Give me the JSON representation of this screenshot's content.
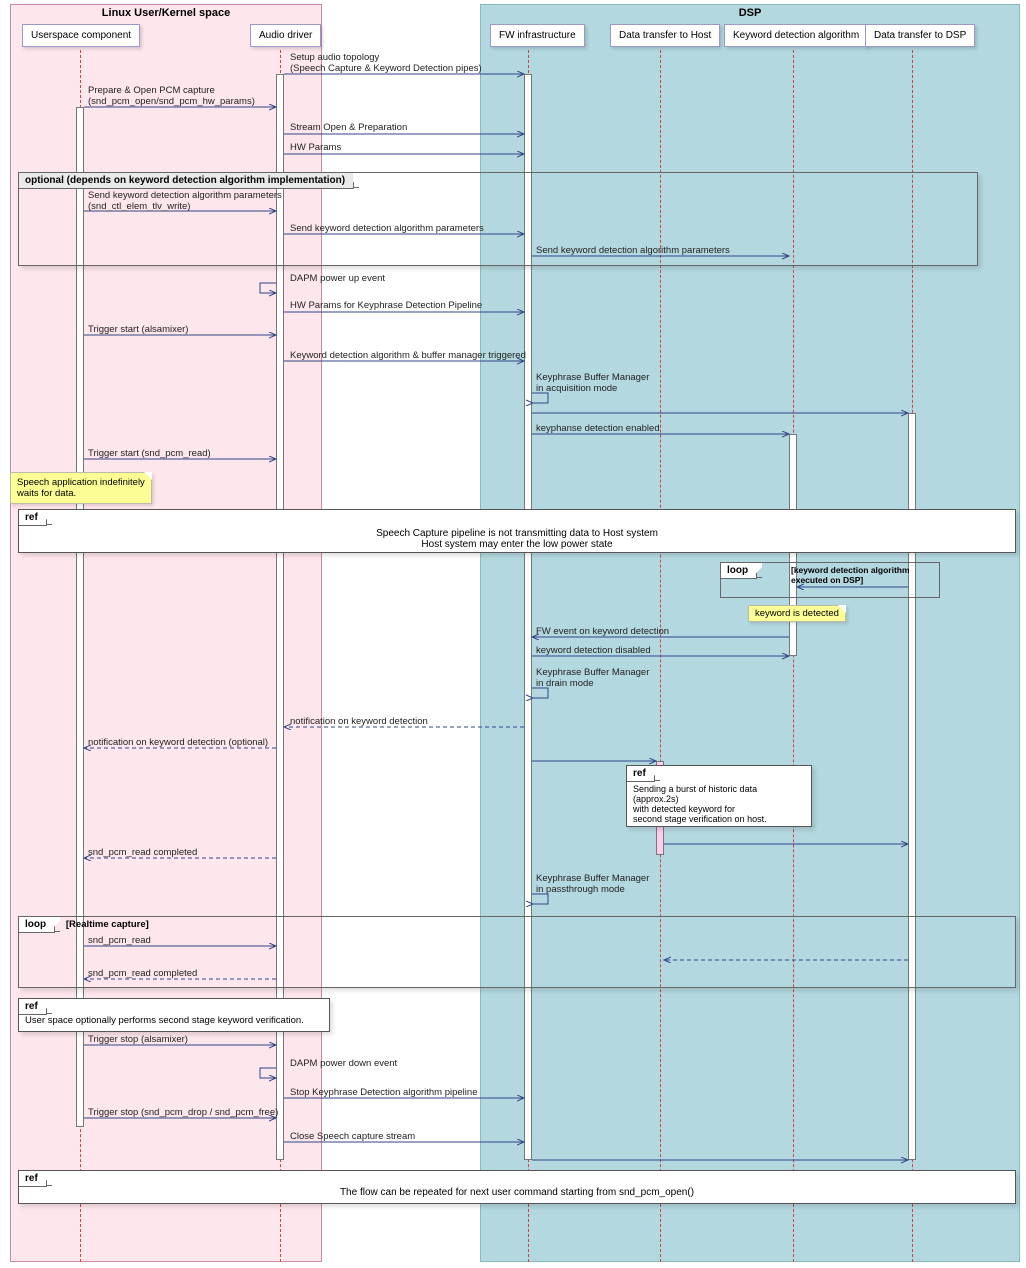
{
  "groups": {
    "linux": "Linux User/Kernel space",
    "dsp": "DSP"
  },
  "participants": {
    "user": "Userspace component",
    "driver": "Audio driver",
    "fw": "FW infrastructure",
    "dthost": "Data transfer to Host",
    "kwd": "Keyword detection algorithm",
    "dtdsp": "Data transfer to DSP"
  },
  "msgs": {
    "setup1": "Setup audio topology",
    "setup2": "(Speech Capture & Keyword Detection pipes)",
    "prepare1": "Prepare & Open PCM capture",
    "prepare2": "(snd_pcm_open/snd_pcm_hw_params)",
    "stream_open": "Stream Open & Preparation",
    "hw_params": "HW Params",
    "opt_guard": "optional (depends on keyword detection algorithm implementation)",
    "send_kwd1": "Send keyword detection algorithm parameters",
    "send_kwd1b": "(snd_ctl_elem_tlv_write)",
    "send_kwd2": "Send keyword detection algorithm parameters",
    "send_kwd3": "Send keyword detection algorithm parameters",
    "dapm_up": "DAPM power up event",
    "hw_kpd": "HW Params for Keyphrase Detection Pipeline",
    "trig_alsa": "Trigger start (alsamixer)",
    "kwd_trig": "Keyword detection algorithm & buffer manager triggered",
    "kbm_acq1": "Keyphrase Buffer Manager",
    "kbm_acq2": "in acquisition mode",
    "kp_enable": "keyphanse detection enabled",
    "trig_read": "Trigger start (snd_pcm_read)",
    "note_wait1": "Speech application indefinitely",
    "note_wait2": "waits for data.",
    "ref1a": "Speech Capture pipeline is not transmitting data to Host system",
    "ref1b": "Host system may enter the low power state",
    "loop_guard": "[keyword detection algorithm",
    "loop_guard2": "executed on DSP]",
    "loop_label": "loop",
    "note_detected": "keyword is detected",
    "fw_evt": "FW event on keyword detection",
    "kwd_disable": "keyword detection disabled",
    "kbm_drain1": "Keyphrase Buffer Manager",
    "kbm_drain2": "in drain mode",
    "notif_drv": "notification on keyword detection",
    "notif_user": "notification on keyword detection (optional)",
    "ref2a": "Sending a burst of historic data (approx.2s)",
    "ref2b": "with detected keyword for",
    "ref2c": "second stage verification on host.",
    "read_done": "snd_pcm_read completed",
    "kbm_pass1": "Keyphrase Buffer Manager",
    "kbm_pass2": "in passthrough mode",
    "realtime_label": "loop",
    "realtime_guard": "[Realtime capture]",
    "read": "snd_pcm_read",
    "read_done2": "snd_pcm_read completed",
    "ref3": "User space optionally performs second stage keyword verification.",
    "trig_stop_alsa": "Trigger stop (alsamixer)",
    "dapm_down": "DAPM power down event",
    "stop_pipe": "Stop Keyphrase Detection algorithm pipeline",
    "trig_stop_pcm": "Trigger stop (snd_pcm_drop / snd_pcm_free)",
    "close_stream": "Close Speech capture stream",
    "ref4": "The flow can be repeated for next user command starting from snd_pcm_open()",
    "ref_label": "ref"
  }
}
